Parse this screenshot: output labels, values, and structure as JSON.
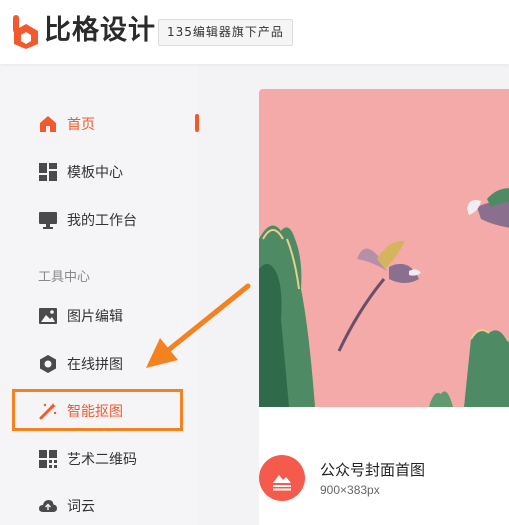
{
  "brand": {
    "logo_text": "比格设计",
    "tagline": "135编辑器旗下产品"
  },
  "sidebar": {
    "items": [
      {
        "label": "首页",
        "icon": "home-icon",
        "active": true
      },
      {
        "label": "模板中心",
        "icon": "template-grid-icon"
      },
      {
        "label": "我的工作台",
        "icon": "monitor-icon"
      }
    ],
    "section_label": "工具中心",
    "tools": [
      {
        "label": "图片编辑",
        "icon": "image-edit-icon"
      },
      {
        "label": "在线拼图",
        "icon": "collage-icon"
      },
      {
        "label": "智能抠图",
        "icon": "magic-wand-icon",
        "highlighted": true
      },
      {
        "label": "艺术二维码",
        "icon": "qrcode-icon"
      },
      {
        "label": "词云",
        "icon": "cloud-icon"
      }
    ]
  },
  "main": {
    "card": {
      "title": "公众号封面首图",
      "size": "900×383px"
    }
  },
  "colors": {
    "accent": "#f2592c",
    "highlight": "#f58220",
    "cover_bg": "#f4aaa8",
    "card_icon": "#f45b4c"
  }
}
